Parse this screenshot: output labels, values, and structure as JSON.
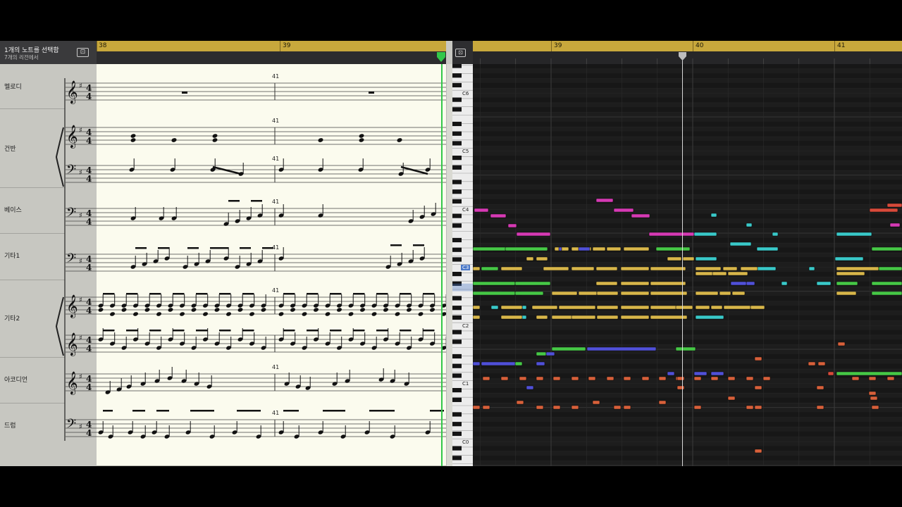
{
  "header": {
    "title": "1개의 노트를 선택함",
    "subtitle": "7개의 리전에서"
  },
  "score": {
    "ruler_bars": [
      {
        "label": "38",
        "pos": 0
      },
      {
        "label": "39",
        "pos": 1
      }
    ],
    "measure_numbers": [
      "41"
    ],
    "tracks": [
      {
        "name": "멜로디"
      },
      {
        "name": "건반"
      },
      {
        "name": "베이스"
      },
      {
        "name": "기타1"
      },
      {
        "name": "기타2"
      },
      {
        "name": "아코디언"
      },
      {
        "name": "드럼"
      }
    ],
    "clefs": [
      "treble",
      "grand",
      "bass",
      "bass",
      "grand-treble",
      "treble",
      "bass"
    ],
    "time_signature": {
      "top": "4",
      "bottom": "4"
    }
  },
  "piano_roll": {
    "ruler_bars": [
      "39",
      "40",
      "41"
    ],
    "octave_labels": [
      "C6",
      "C5",
      "C4",
      "C3",
      "C2",
      "C1",
      "C0"
    ],
    "highlighted_key": "C3",
    "colors": {
      "magenta": "#d63ab4",
      "cyan": "#39c9c9",
      "yellow": "#d8b64a",
      "green": "#46c846",
      "blue": "#5050d8",
      "orange": "#d8603a",
      "red": "#d84a3a",
      "accent_ruler": "#c8a83c",
      "playhead_green": "#33c74a"
    }
  }
}
